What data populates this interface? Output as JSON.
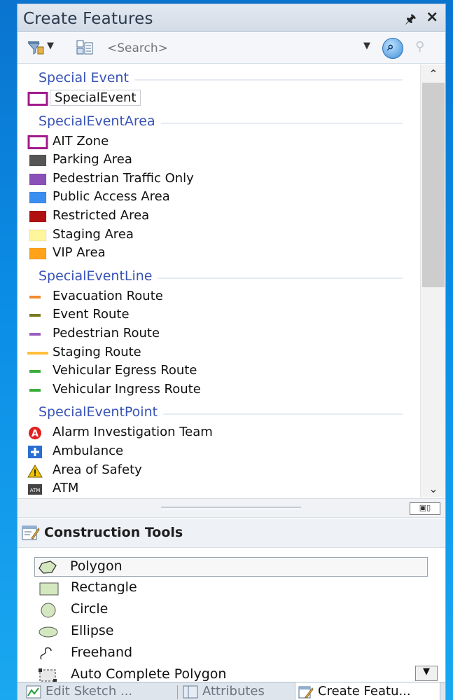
{
  "window": {
    "title": "Create Features"
  },
  "toolbar": {
    "search_placeholder": "<Search>"
  },
  "groups": [
    {
      "name": "Special Event",
      "items": [
        {
          "label": "SpecialEvent",
          "symbol": "polygon-outline",
          "color": "#a21a8c",
          "selected": true
        }
      ]
    },
    {
      "name": "SpecialEventArea",
      "items": [
        {
          "label": "AIT Zone",
          "symbol": "polygon-outline",
          "color": "#a21a8c"
        },
        {
          "label": "Parking Area",
          "symbol": "fill",
          "color": "#555555"
        },
        {
          "label": "Pedestrian Traffic Only",
          "symbol": "fill",
          "color": "#8b4fb8"
        },
        {
          "label": "Public Access Area",
          "symbol": "fill",
          "color": "#3a8ef0"
        },
        {
          "label": "Restricted Area",
          "symbol": "fill",
          "color": "#b01010"
        },
        {
          "label": "Staging Area",
          "symbol": "fill",
          "color": "#fff59a"
        },
        {
          "label": "VIP Area",
          "symbol": "fill",
          "color": "#ffa21a"
        }
      ]
    },
    {
      "name": "SpecialEventLine",
      "items": [
        {
          "label": "Evacuation Route",
          "symbol": "line-short",
          "color": "#f08a2c"
        },
        {
          "label": "Event Route",
          "symbol": "line-short",
          "color": "#7a7a1e"
        },
        {
          "label": "Pedestrian Route",
          "symbol": "line-short",
          "color": "#9b5fbf"
        },
        {
          "label": "Staging Route",
          "symbol": "line-long",
          "color": "#ffbf3a"
        },
        {
          "label": "Vehicular Egress Route",
          "symbol": "line-short",
          "color": "#3cae3c"
        },
        {
          "label": "Vehicular Ingress Route",
          "symbol": "line-short",
          "color": "#3cae3c"
        }
      ]
    },
    {
      "name": "SpecialEventPoint",
      "items": [
        {
          "label": "Alarm Investigation Team",
          "symbol": "alarm-icon",
          "color": "#e02020"
        },
        {
          "label": "Ambulance",
          "symbol": "ambulance-icon",
          "color": "#2a6fd0"
        },
        {
          "label": "Area of Safety",
          "symbol": "warning-icon",
          "color": "#f2c200"
        },
        {
          "label": "ATM",
          "symbol": "atm-icon",
          "color": "#444444"
        }
      ]
    }
  ],
  "construction_tools": {
    "title": "Construction Tools",
    "tools": [
      {
        "label": "Polygon",
        "icon": "polygon-icon",
        "selected": true
      },
      {
        "label": "Rectangle",
        "icon": "rectangle-icon"
      },
      {
        "label": "Circle",
        "icon": "circle-icon"
      },
      {
        "label": "Ellipse",
        "icon": "ellipse-icon"
      },
      {
        "label": "Freehand",
        "icon": "freehand-icon"
      },
      {
        "label": "Auto Complete Polygon",
        "icon": "auto-complete-polygon-icon"
      }
    ]
  },
  "tabs": [
    {
      "label": "Edit Sketch ...",
      "icon": "edit-sketch-icon"
    },
    {
      "label": "Attributes",
      "icon": "attributes-icon"
    },
    {
      "label": "Create Featu...",
      "icon": "create-features-icon",
      "active": true
    }
  ]
}
